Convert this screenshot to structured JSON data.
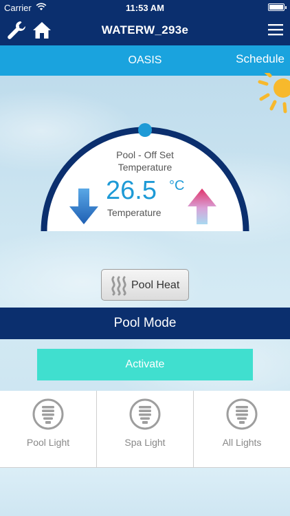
{
  "status": {
    "carrier": "Carrier",
    "time": "11:53 AM"
  },
  "nav": {
    "title": "WATERW_293e"
  },
  "sub": {
    "name": "OASIS",
    "schedule": "Schedule"
  },
  "gauge": {
    "label_line1": "Pool - Off Set",
    "label_line2": "Temperature",
    "value": "26.5",
    "unit": "°C",
    "sublabel": "Temperature"
  },
  "pool_heat": {
    "label": "Pool Heat"
  },
  "pool_mode": {
    "label": "Pool Mode"
  },
  "activate": {
    "label": "Activate"
  },
  "lights": [
    {
      "label": "Pool Light"
    },
    {
      "label": "Spa Light"
    },
    {
      "label": "All Lights"
    }
  ],
  "colors": {
    "navy": "#0b2f6e",
    "sky": "#1aa3de",
    "accent": "#1e9ad6",
    "teal": "#40dfcf",
    "sun": "#f7b92c"
  },
  "icons": {
    "nav_left": [
      "wrench-icon",
      "home-icon"
    ],
    "nav_right": "menu-icon",
    "weather": "sun-icon",
    "temp_down": "arrow-down-icon",
    "temp_up": "arrow-up-icon",
    "heat": "heat-waves-icon",
    "light": "bulb-icon"
  }
}
